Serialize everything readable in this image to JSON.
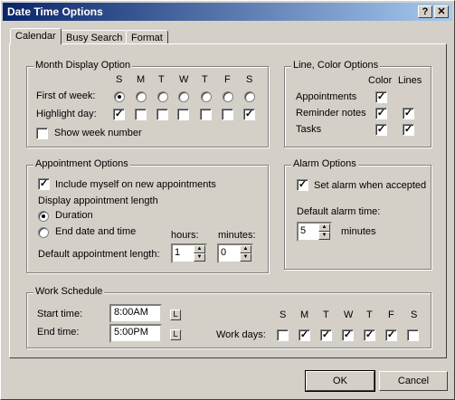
{
  "window": {
    "title": "Date Time Options",
    "help_label": "?",
    "close_label": "✕"
  },
  "tabs": [
    {
      "label": "Calendar",
      "active": true
    },
    {
      "label": "Busy Search",
      "active": false
    },
    {
      "label": "Format",
      "active": false
    }
  ],
  "month_display": {
    "title": "Month Display Option",
    "days": [
      "S",
      "M",
      "T",
      "W",
      "T",
      "F",
      "S"
    ],
    "first_of_week_label": "First of week:",
    "first_of_week_selected": 0,
    "highlight_day_label": "Highlight day:",
    "highlight_checked": [
      true,
      false,
      false,
      false,
      false,
      false,
      true
    ],
    "show_week_number_label": "Show week number",
    "show_week_number": false
  },
  "line_color": {
    "title": "Line, Color Options",
    "col_color": "Color",
    "col_lines": "Lines",
    "rows": [
      {
        "label": "Appointments",
        "color": true,
        "lines": null
      },
      {
        "label": "Reminder notes",
        "color": true,
        "lines": true
      },
      {
        "label": "Tasks",
        "color": true,
        "lines": true
      }
    ]
  },
  "appointment": {
    "title": "Appointment Options",
    "include_myself_label": "Include myself on new appointments",
    "include_myself": true,
    "display_length_label": "Display appointment length",
    "duration_label": "Duration",
    "end_label": "End date and time",
    "selected": "duration",
    "default_length_label": "Default appointment length:",
    "hours_label": "hours:",
    "hours_value": "1",
    "minutes_label": "minutes:",
    "minutes_value": "0"
  },
  "alarm": {
    "title": "Alarm Options",
    "set_alarm_label": "Set alarm when accepted",
    "set_alarm": true,
    "default_time_label": "Default alarm time:",
    "value": "5",
    "unit_label": "minutes"
  },
  "work_schedule": {
    "title": "Work Schedule",
    "start_label": "Start time:",
    "start_value": "8:00AM",
    "end_label": "End time:",
    "end_value": "5:00PM",
    "work_days_label": "Work days:",
    "days": [
      "S",
      "M",
      "T",
      "W",
      "T",
      "F",
      "S"
    ],
    "checked": [
      false,
      true,
      true,
      true,
      true,
      true,
      false
    ]
  },
  "buttons": {
    "ok": "OK",
    "cancel": "Cancel"
  }
}
